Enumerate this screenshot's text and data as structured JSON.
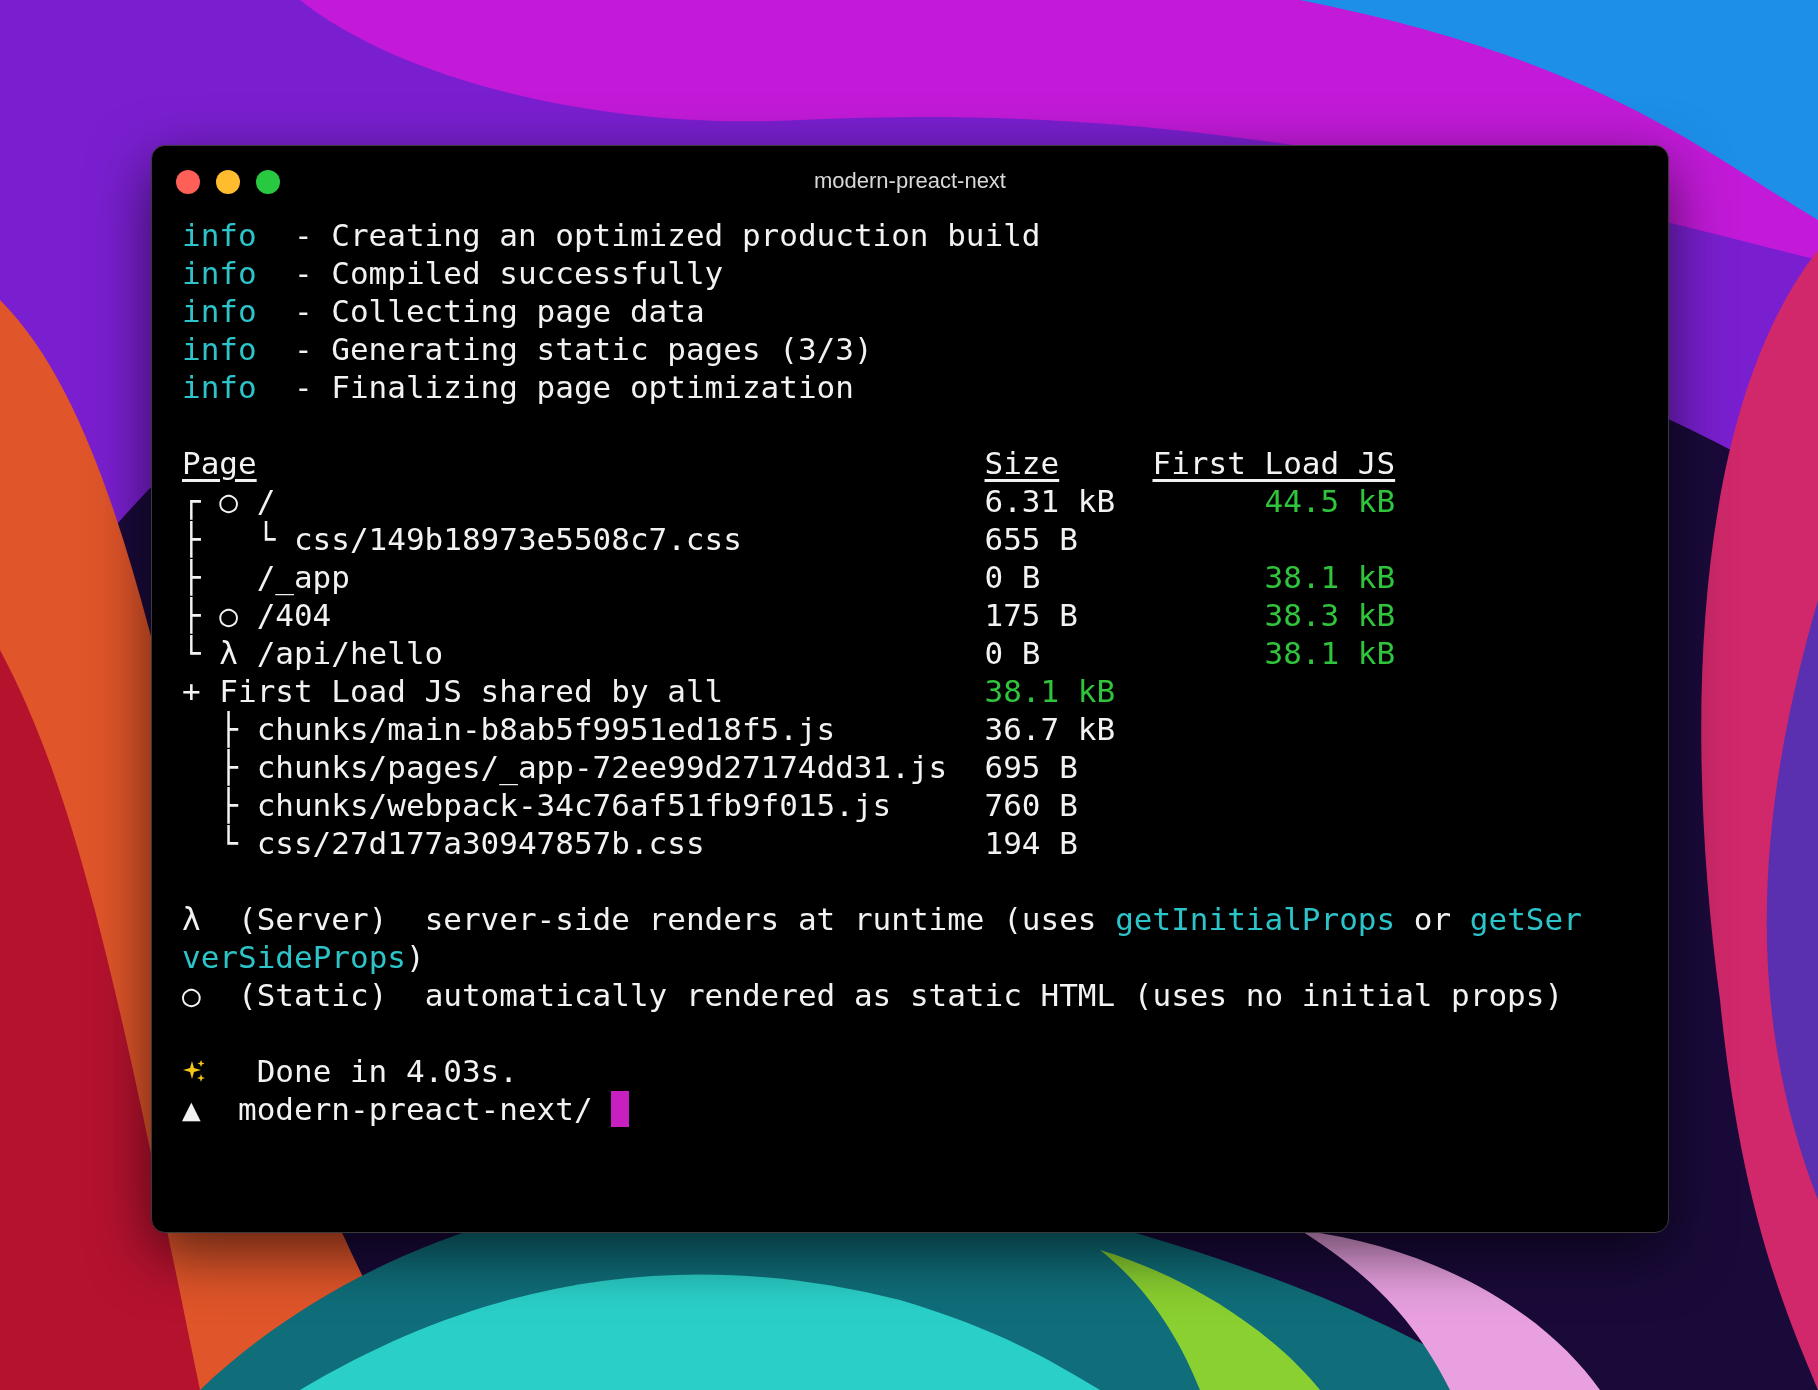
{
  "window": {
    "title": "modern-preact-next"
  },
  "log": [
    {
      "level": "info",
      "message": "- Creating an optimized production build"
    },
    {
      "level": "info",
      "message": "- Compiled successfully"
    },
    {
      "level": "info",
      "message": "- Collecting page data"
    },
    {
      "level": "info",
      "message": "- Generating static pages (3/3)"
    },
    {
      "level": "info",
      "message": "- Finalizing page optimization"
    }
  ],
  "table": {
    "columns": [
      "Page",
      "Size",
      "First Load JS"
    ],
    "routes": [
      {
        "branch": "┌",
        "symbol": "○",
        "name": "/",
        "size": "6.31 kB",
        "first_load": "44.5 kB"
      },
      {
        "branch": "├",
        "sub": "└",
        "name": "css/149b18973e5508c7.css",
        "size": "655 B"
      },
      {
        "branch": "├",
        "name": "/_app",
        "size": "0 B",
        "first_load": "38.1 kB"
      },
      {
        "branch": "├",
        "symbol": "○",
        "name": "/404",
        "size": "175 B",
        "first_load": "38.3 kB"
      },
      {
        "branch": "└",
        "symbol": "λ",
        "name": "/api/hello",
        "size": "0 B",
        "first_load": "38.1 kB"
      }
    ],
    "shared": {
      "marker": "+",
      "label": "First Load JS shared by all",
      "size": "38.1 kB",
      "chunks": [
        {
          "branch": "├",
          "name": "chunks/main-b8ab5f9951ed18f5.js",
          "size": "36.7 kB"
        },
        {
          "branch": "├",
          "name": "chunks/pages/_app-72ee99d27174dd31.js",
          "size": "695 B"
        },
        {
          "branch": "├",
          "name": "chunks/webpack-34c76af51fb9f015.js",
          "size": "760 B"
        },
        {
          "branch": "└",
          "name": "css/27d177a30947857b.css",
          "size": "194 B"
        }
      ]
    }
  },
  "legend": [
    [
      {
        "kind": "plain",
        "text": "λ  (Server)  server-side renders at runtime (uses "
      },
      {
        "kind": "code",
        "text": "getInitialProps"
      },
      {
        "kind": "plain",
        "text": " or "
      },
      {
        "kind": "code",
        "text": "getServerSideProps"
      },
      {
        "kind": "plain",
        "text": ")"
      }
    ],
    [
      {
        "kind": "plain",
        "text": "○  (Static)  automatically rendered as static HTML (uses no initial props)"
      }
    ]
  ],
  "done": "Done in 4.03s.",
  "prompt": {
    "symbol": "▲",
    "path": "modern-preact-next/"
  }
}
